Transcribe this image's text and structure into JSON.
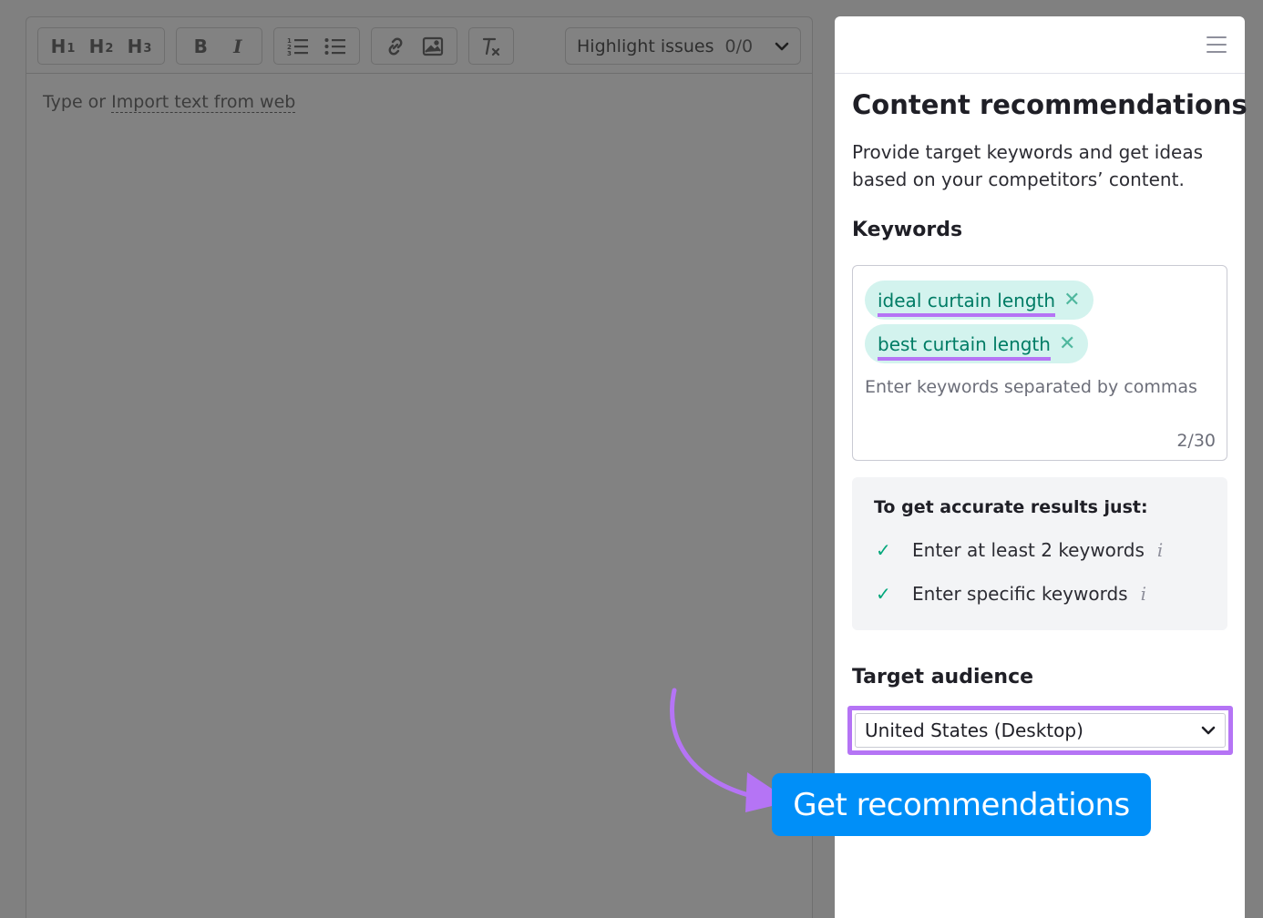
{
  "editor": {
    "toolbar": {
      "h1": "H",
      "h1_sub": "1",
      "h2": "H",
      "h2_sub": "2",
      "h3": "H",
      "h3_sub": "3",
      "bold": "B",
      "italic": "I"
    },
    "highlight_label": "Highlight issues",
    "highlight_count": "0/0",
    "placeholder_prefix": "Type or ",
    "import_link": "Import text from web"
  },
  "panel": {
    "title": "Content recommendations",
    "description": "Provide target keywords and get ideas based on your competitors’ content.",
    "keywords_label": "Keywords",
    "keywords": [
      {
        "label": "ideal curtain length"
      },
      {
        "label": "best curtain length"
      }
    ],
    "keyword_placeholder": "Enter keywords separated by commas",
    "keyword_count": "2/30",
    "tips": {
      "title": "To get accurate results just:",
      "items": [
        {
          "label": "Enter at least 2 keywords"
        },
        {
          "label": "Enter specific keywords"
        }
      ]
    },
    "audience_label": "Target audience",
    "audience_value": "United States (Desktop)",
    "cta_label": "Get recommendations"
  },
  "colors": {
    "cta": "#008ff8",
    "chip_bg": "#d3f3ee",
    "chip_text": "#007c65",
    "highlight": "#b574f5",
    "check": "#00a77b"
  },
  "icons": [
    "list-ordered-icon",
    "list-bullet-icon",
    "link-icon",
    "image-icon",
    "clear-format-icon",
    "chevron-down-icon",
    "menu-icon",
    "close-icon",
    "check-icon",
    "info-icon"
  ]
}
